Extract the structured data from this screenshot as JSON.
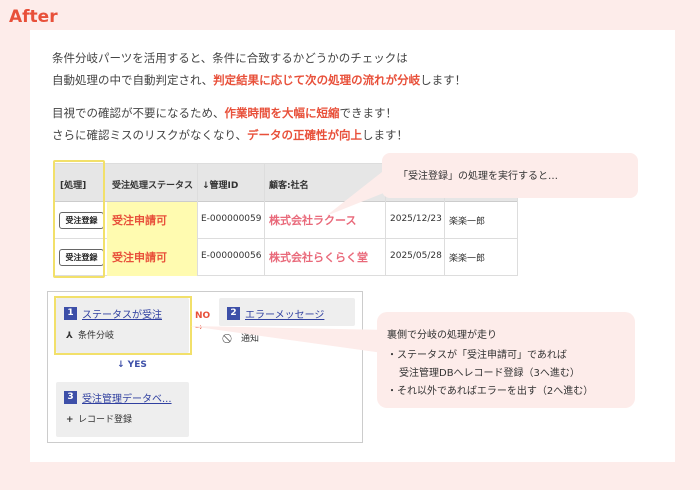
{
  "after_label": "After",
  "intro": {
    "line1": "条件分岐パーツを活用すると、条件に合致するかどうかのチェックは",
    "line2_a": "自動処理の中で自動判定され、",
    "line2_hl": "判定結果に応じて次の処理の流れが分岐",
    "line2_b": "します！",
    "line3_a": "目視での確認が不要になるため、",
    "line3_hl": "作業時間を大幅に短縮",
    "line3_b": "できます！",
    "line4_a": "さらに確認ミスのリスクがなくなり、",
    "line4_hl": "データの正確性が向上",
    "line4_b": "します！"
  },
  "table": {
    "columns": [
      "[処理]",
      "受注処理ステータス",
      "↓管理ID",
      "顧客:社名"
    ],
    "rows": [
      {
        "action": "受注登録",
        "status": "受注申請可",
        "id": "E-000000059",
        "customer": "株式会社ラクース",
        "date": "2025/12/23",
        "person": "楽楽一郎"
      },
      {
        "action": "受注登録",
        "status": "受注申請可",
        "id": "E-000000056",
        "customer": "株式会社らくらく堂",
        "date": "2025/05/28",
        "person": "楽楽一郎"
      }
    ]
  },
  "callout1": "「受注登録」の処理を実行すると…",
  "workflow": {
    "node1": {
      "num": "1",
      "title": "ステータスが受注",
      "sub_icon": "⅄",
      "sub": "条件分岐"
    },
    "node2": {
      "num": "2",
      "title": "エラーメッセージ",
      "sub_icon": "⃠",
      "sub": "通知"
    },
    "node3": {
      "num": "3",
      "title": "受注管理データベ...",
      "sub_icon": "+",
      "sub": "レコード登録"
    },
    "no_label": "NO",
    "yes_label": "↓ YES"
  },
  "callout2": {
    "l1": "裏側で分岐の処理が走り",
    "l2": "・ステータスが「受注申請可」であれば",
    "l3": "受注管理DBへレコード登録（3へ進む）",
    "l4": "・それ以外であればエラーを出す（2へ進む）"
  },
  "colors": {
    "accent": "#e8503a",
    "highlight": "#f2e06a",
    "node_number": "#3d4fa8"
  }
}
